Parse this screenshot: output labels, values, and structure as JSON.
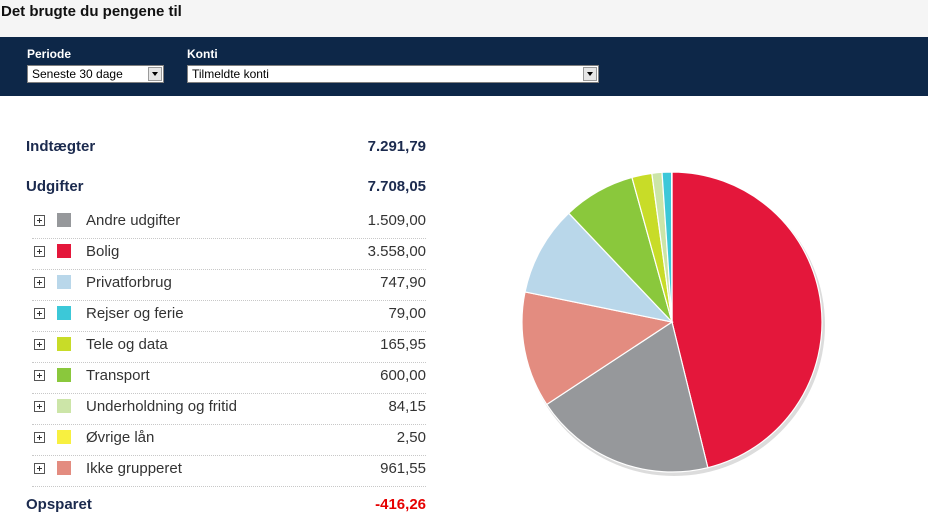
{
  "page": {
    "title": "Det brugte du pengene til"
  },
  "filters": {
    "period_label": "Periode",
    "period_value": "Seneste 30 dage",
    "accounts_label": "Konti",
    "accounts_value": "Tilmeldte konti"
  },
  "summary": {
    "income_label": "Indtægter",
    "income_value": "7.291,79",
    "expenses_label": "Udgifter",
    "expenses_value": "7.708,05",
    "saved_label": "Opsparet",
    "saved_value": "-416,26"
  },
  "categories": [
    {
      "name": "Andre udgifter",
      "amount": "1.509,00",
      "color": "#96989b",
      "icon": "expand-plus-icon"
    },
    {
      "name": "Bolig",
      "amount": "3.558,00",
      "color": "#e4173b",
      "icon": "expand-plus-icon"
    },
    {
      "name": "Privatforbrug",
      "amount": "747,90",
      "color": "#b9d7ea",
      "icon": "expand-plus-icon"
    },
    {
      "name": "Rejser og ferie",
      "amount": "79,00",
      "color": "#3cc8d8",
      "icon": "expand-plus-icon"
    },
    {
      "name": "Tele og data",
      "amount": "165,95",
      "color": "#c8dc28",
      "icon": "expand-plus-icon"
    },
    {
      "name": "Transport",
      "amount": "600,00",
      "color": "#8ac83c",
      "icon": "expand-plus-icon"
    },
    {
      "name": "Underholdning og fritid",
      "amount": "84,15",
      "color": "#cce5a8",
      "icon": "expand-plus-icon"
    },
    {
      "name": "Øvrige lån",
      "amount": "2,50",
      "color": "#f8f040",
      "icon": "expand-plus-icon"
    },
    {
      "name": "Ikke grupperet",
      "amount": "961,55",
      "color": "#e38c80",
      "icon": "expand-plus-icon"
    }
  ],
  "chart_data": {
    "type": "pie",
    "start": "top",
    "direction": "clockwise",
    "slices": [
      {
        "label": "Bolig",
        "value": 3558.0,
        "color": "#e4173b"
      },
      {
        "label": "Andre udgifter",
        "value": 1509.0,
        "color": "#96989b"
      },
      {
        "label": "Ikke grupperet",
        "value": 961.55,
        "color": "#e38c80"
      },
      {
        "label": "Privatforbrug",
        "value": 747.9,
        "color": "#b9d7ea"
      },
      {
        "label": "Transport",
        "value": 600.0,
        "color": "#8ac83c"
      },
      {
        "label": "Tele og data",
        "value": 165.95,
        "color": "#c8dc28"
      },
      {
        "label": "Underholdning og fritid",
        "value": 84.15,
        "color": "#cce5a8"
      },
      {
        "label": "Rejser og ferie",
        "value": 79.0,
        "color": "#3cc8d8"
      },
      {
        "label": "Øvrige lån",
        "value": 2.5,
        "color": "#f8f040"
      }
    ]
  }
}
